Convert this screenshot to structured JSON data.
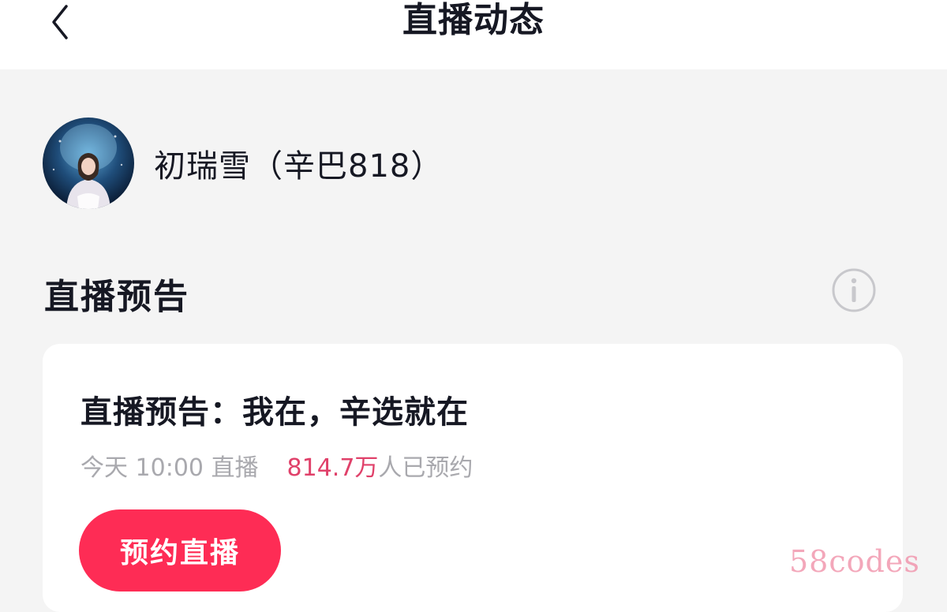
{
  "header": {
    "title": "直播动态",
    "back_icon": "chevron-left-icon"
  },
  "profile": {
    "name": "初瑞雪（辛巴818）",
    "avatar": "avatar-image"
  },
  "section": {
    "title": "直播预告",
    "info_icon": "info-icon"
  },
  "card": {
    "title": "直播预告：我在，辛选就在",
    "time": "今天 10:00 直播",
    "count": "814.7万",
    "count_suffix": "人已预约",
    "button_label": "预约直播"
  },
  "watermark": "58codes",
  "colors": {
    "accent": "#fe2c55",
    "count_text": "#e0416a",
    "muted_text": "#a9a9ae",
    "background": "#f4f4f4"
  }
}
